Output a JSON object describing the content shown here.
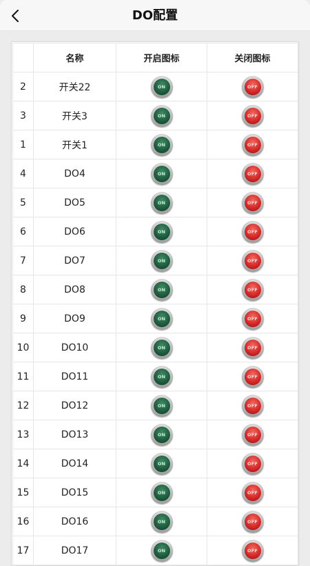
{
  "header": {
    "back_icon": "chevron-left-icon",
    "title": "DO配置"
  },
  "table": {
    "columns": [
      "",
      "名称",
      "开启图标",
      "关闭图标"
    ],
    "on_label": "ON",
    "off_label": "OFF",
    "on_color": "#1d5a3d",
    "off_color": "#d32424",
    "rows": [
      {
        "num": "2",
        "name": "开关22"
      },
      {
        "num": "3",
        "name": "开关3"
      },
      {
        "num": "1",
        "name": "开关1"
      },
      {
        "num": "4",
        "name": "DO4"
      },
      {
        "num": "5",
        "name": "DO5"
      },
      {
        "num": "6",
        "name": "DO6"
      },
      {
        "num": "7",
        "name": "DO7"
      },
      {
        "num": "8",
        "name": "DO8"
      },
      {
        "num": "9",
        "name": "DO9"
      },
      {
        "num": "10",
        "name": "DO10"
      },
      {
        "num": "11",
        "name": "DO11"
      },
      {
        "num": "12",
        "name": "DO12"
      },
      {
        "num": "13",
        "name": "DO13"
      },
      {
        "num": "14",
        "name": "DO14"
      },
      {
        "num": "15",
        "name": "DO15"
      },
      {
        "num": "16",
        "name": "DO16"
      },
      {
        "num": "17",
        "name": "DO17"
      }
    ]
  }
}
